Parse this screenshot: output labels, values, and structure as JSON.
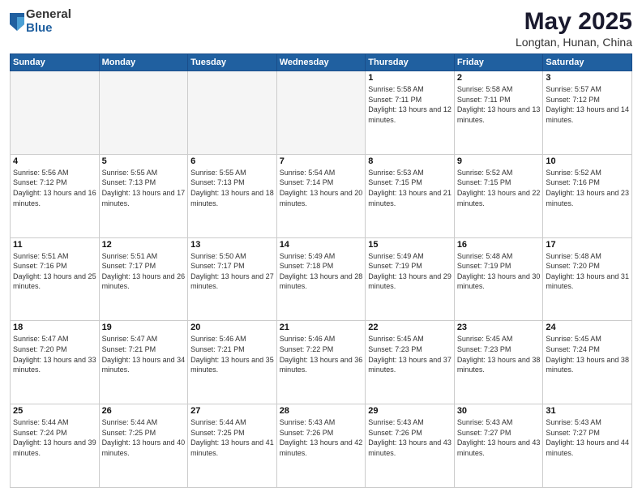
{
  "header": {
    "logo_general": "General",
    "logo_blue": "Blue",
    "month_title": "May 2025",
    "location": "Longtan, Hunan, China"
  },
  "days_of_week": [
    "Sunday",
    "Monday",
    "Tuesday",
    "Wednesday",
    "Thursday",
    "Friday",
    "Saturday"
  ],
  "weeks": [
    [
      {
        "date": "",
        "sunrise": "",
        "sunset": "",
        "daylight": "",
        "empty": true
      },
      {
        "date": "",
        "sunrise": "",
        "sunset": "",
        "daylight": "",
        "empty": true
      },
      {
        "date": "",
        "sunrise": "",
        "sunset": "",
        "daylight": "",
        "empty": true
      },
      {
        "date": "",
        "sunrise": "",
        "sunset": "",
        "daylight": "",
        "empty": true
      },
      {
        "date": "1",
        "sunrise": "Sunrise: 5:58 AM",
        "sunset": "Sunset: 7:11 PM",
        "daylight": "Daylight: 13 hours and 12 minutes.",
        "empty": false
      },
      {
        "date": "2",
        "sunrise": "Sunrise: 5:58 AM",
        "sunset": "Sunset: 7:11 PM",
        "daylight": "Daylight: 13 hours and 13 minutes.",
        "empty": false
      },
      {
        "date": "3",
        "sunrise": "Sunrise: 5:57 AM",
        "sunset": "Sunset: 7:12 PM",
        "daylight": "Daylight: 13 hours and 14 minutes.",
        "empty": false
      }
    ],
    [
      {
        "date": "4",
        "sunrise": "Sunrise: 5:56 AM",
        "sunset": "Sunset: 7:12 PM",
        "daylight": "Daylight: 13 hours and 16 minutes.",
        "empty": false
      },
      {
        "date": "5",
        "sunrise": "Sunrise: 5:55 AM",
        "sunset": "Sunset: 7:13 PM",
        "daylight": "Daylight: 13 hours and 17 minutes.",
        "empty": false
      },
      {
        "date": "6",
        "sunrise": "Sunrise: 5:55 AM",
        "sunset": "Sunset: 7:13 PM",
        "daylight": "Daylight: 13 hours and 18 minutes.",
        "empty": false
      },
      {
        "date": "7",
        "sunrise": "Sunrise: 5:54 AM",
        "sunset": "Sunset: 7:14 PM",
        "daylight": "Daylight: 13 hours and 20 minutes.",
        "empty": false
      },
      {
        "date": "8",
        "sunrise": "Sunrise: 5:53 AM",
        "sunset": "Sunset: 7:15 PM",
        "daylight": "Daylight: 13 hours and 21 minutes.",
        "empty": false
      },
      {
        "date": "9",
        "sunrise": "Sunrise: 5:52 AM",
        "sunset": "Sunset: 7:15 PM",
        "daylight": "Daylight: 13 hours and 22 minutes.",
        "empty": false
      },
      {
        "date": "10",
        "sunrise": "Sunrise: 5:52 AM",
        "sunset": "Sunset: 7:16 PM",
        "daylight": "Daylight: 13 hours and 23 minutes.",
        "empty": false
      }
    ],
    [
      {
        "date": "11",
        "sunrise": "Sunrise: 5:51 AM",
        "sunset": "Sunset: 7:16 PM",
        "daylight": "Daylight: 13 hours and 25 minutes.",
        "empty": false
      },
      {
        "date": "12",
        "sunrise": "Sunrise: 5:51 AM",
        "sunset": "Sunset: 7:17 PM",
        "daylight": "Daylight: 13 hours and 26 minutes.",
        "empty": false
      },
      {
        "date": "13",
        "sunrise": "Sunrise: 5:50 AM",
        "sunset": "Sunset: 7:17 PM",
        "daylight": "Daylight: 13 hours and 27 minutes.",
        "empty": false
      },
      {
        "date": "14",
        "sunrise": "Sunrise: 5:49 AM",
        "sunset": "Sunset: 7:18 PM",
        "daylight": "Daylight: 13 hours and 28 minutes.",
        "empty": false
      },
      {
        "date": "15",
        "sunrise": "Sunrise: 5:49 AM",
        "sunset": "Sunset: 7:19 PM",
        "daylight": "Daylight: 13 hours and 29 minutes.",
        "empty": false
      },
      {
        "date": "16",
        "sunrise": "Sunrise: 5:48 AM",
        "sunset": "Sunset: 7:19 PM",
        "daylight": "Daylight: 13 hours and 30 minutes.",
        "empty": false
      },
      {
        "date": "17",
        "sunrise": "Sunrise: 5:48 AM",
        "sunset": "Sunset: 7:20 PM",
        "daylight": "Daylight: 13 hours and 31 minutes.",
        "empty": false
      }
    ],
    [
      {
        "date": "18",
        "sunrise": "Sunrise: 5:47 AM",
        "sunset": "Sunset: 7:20 PM",
        "daylight": "Daylight: 13 hours and 33 minutes.",
        "empty": false
      },
      {
        "date": "19",
        "sunrise": "Sunrise: 5:47 AM",
        "sunset": "Sunset: 7:21 PM",
        "daylight": "Daylight: 13 hours and 34 minutes.",
        "empty": false
      },
      {
        "date": "20",
        "sunrise": "Sunrise: 5:46 AM",
        "sunset": "Sunset: 7:21 PM",
        "daylight": "Daylight: 13 hours and 35 minutes.",
        "empty": false
      },
      {
        "date": "21",
        "sunrise": "Sunrise: 5:46 AM",
        "sunset": "Sunset: 7:22 PM",
        "daylight": "Daylight: 13 hours and 36 minutes.",
        "empty": false
      },
      {
        "date": "22",
        "sunrise": "Sunrise: 5:45 AM",
        "sunset": "Sunset: 7:23 PM",
        "daylight": "Daylight: 13 hours and 37 minutes.",
        "empty": false
      },
      {
        "date": "23",
        "sunrise": "Sunrise: 5:45 AM",
        "sunset": "Sunset: 7:23 PM",
        "daylight": "Daylight: 13 hours and 38 minutes.",
        "empty": false
      },
      {
        "date": "24",
        "sunrise": "Sunrise: 5:45 AM",
        "sunset": "Sunset: 7:24 PM",
        "daylight": "Daylight: 13 hours and 38 minutes.",
        "empty": false
      }
    ],
    [
      {
        "date": "25",
        "sunrise": "Sunrise: 5:44 AM",
        "sunset": "Sunset: 7:24 PM",
        "daylight": "Daylight: 13 hours and 39 minutes.",
        "empty": false
      },
      {
        "date": "26",
        "sunrise": "Sunrise: 5:44 AM",
        "sunset": "Sunset: 7:25 PM",
        "daylight": "Daylight: 13 hours and 40 minutes.",
        "empty": false
      },
      {
        "date": "27",
        "sunrise": "Sunrise: 5:44 AM",
        "sunset": "Sunset: 7:25 PM",
        "daylight": "Daylight: 13 hours and 41 minutes.",
        "empty": false
      },
      {
        "date": "28",
        "sunrise": "Sunrise: 5:43 AM",
        "sunset": "Sunset: 7:26 PM",
        "daylight": "Daylight: 13 hours and 42 minutes.",
        "empty": false
      },
      {
        "date": "29",
        "sunrise": "Sunrise: 5:43 AM",
        "sunset": "Sunset: 7:26 PM",
        "daylight": "Daylight: 13 hours and 43 minutes.",
        "empty": false
      },
      {
        "date": "30",
        "sunrise": "Sunrise: 5:43 AM",
        "sunset": "Sunset: 7:27 PM",
        "daylight": "Daylight: 13 hours and 43 minutes.",
        "empty": false
      },
      {
        "date": "31",
        "sunrise": "Sunrise: 5:43 AM",
        "sunset": "Sunset: 7:27 PM",
        "daylight": "Daylight: 13 hours and 44 minutes.",
        "empty": false
      }
    ]
  ]
}
